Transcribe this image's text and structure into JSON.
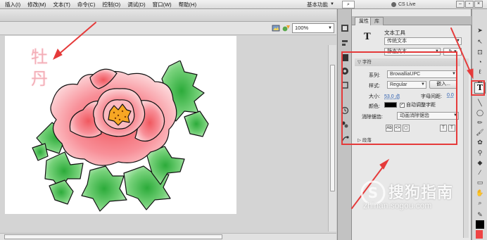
{
  "menubar": {
    "items": [
      "插入(I)",
      "修改(M)",
      "文本(T)",
      "命令(C)",
      "控制(O)",
      "调试(D)",
      "窗口(W)",
      "帮助(H)"
    ],
    "workspace_label": "基本功能",
    "cs_live": "CS Live"
  },
  "stage": {
    "zoom": "100%",
    "canvas_text": "牡丹"
  },
  "properties": {
    "tabs": {
      "properties": "属性",
      "library": "库"
    },
    "tool_name": "文本工具",
    "text_type": "传统文本",
    "text_mode": "静态文本",
    "character": {
      "header": "字符",
      "family_label": "系列:",
      "family_value": "BrowalliaUPC",
      "style_label": "样式:",
      "style_value": "Regular",
      "embed_label": "嵌入...",
      "size_label": "大小:",
      "size_value": "53.0 点",
      "spacing_label": "字母间距:",
      "spacing_value": "0.0",
      "color_label": "颜色:",
      "auto_kern_label": "自动调整字距",
      "antialias_label": "消除锯齿:",
      "antialias_value": "动画消除锯齿"
    },
    "paragraph_header": "段落"
  },
  "watermark": {
    "title": "搜狗指南",
    "url": "zhinan.sogou.com"
  },
  "colors": {
    "annotation_red": "#e53a3a",
    "petal_pink": "#f8a9b0",
    "leaf_green": "#3cb84a",
    "stamen_orange": "#f7a623"
  }
}
